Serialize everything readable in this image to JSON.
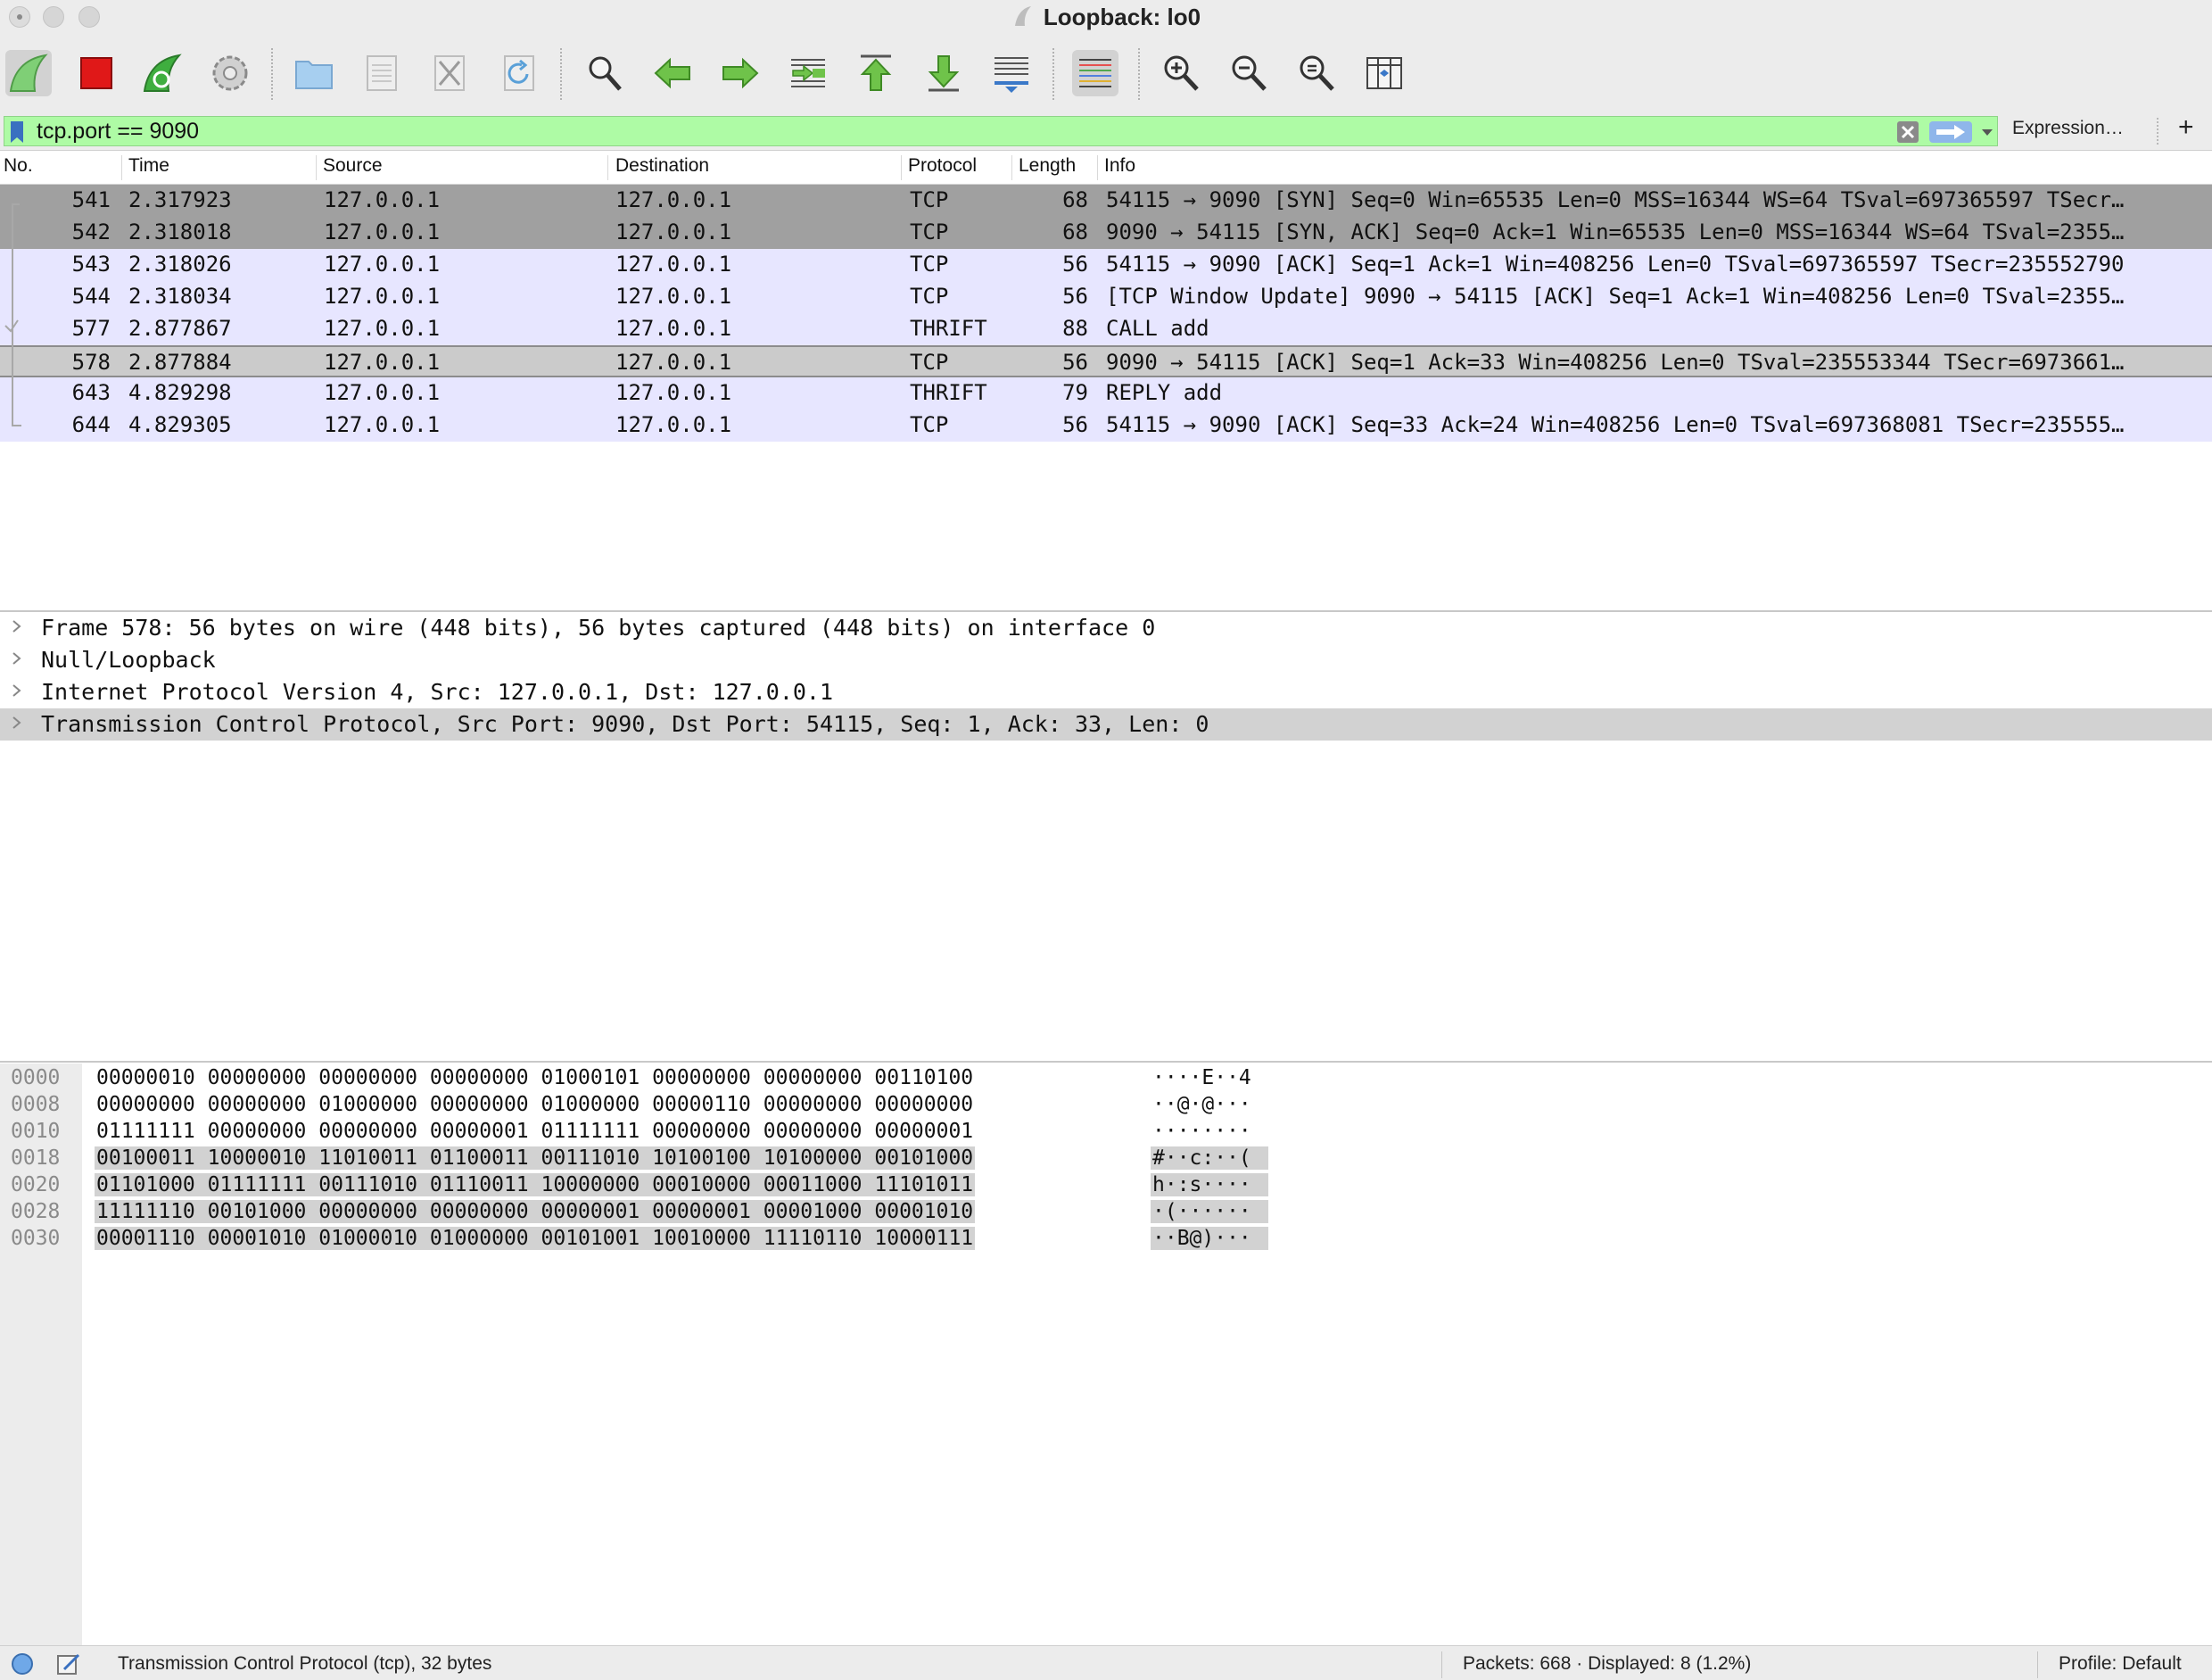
{
  "window": {
    "title": "Loopback: lo0"
  },
  "toolbar": {
    "buttons": [
      {
        "name": "start-capture-icon"
      },
      {
        "name": "stop-capture-icon"
      },
      {
        "name": "restart-capture-icon"
      },
      {
        "name": "capture-options-icon"
      },
      {
        "name": "open-file-icon"
      },
      {
        "name": "save-file-icon"
      },
      {
        "name": "close-file-icon"
      },
      {
        "name": "reload-file-icon"
      },
      {
        "name": "find-packet-icon"
      },
      {
        "name": "go-back-icon"
      },
      {
        "name": "go-forward-icon"
      },
      {
        "name": "go-to-packet-icon"
      },
      {
        "name": "first-packet-icon"
      },
      {
        "name": "last-packet-icon"
      },
      {
        "name": "autoscroll-icon"
      },
      {
        "name": "colorize-icon"
      },
      {
        "name": "zoom-in-icon"
      },
      {
        "name": "zoom-out-icon"
      },
      {
        "name": "normal-size-icon"
      },
      {
        "name": "resize-columns-icon"
      }
    ]
  },
  "filter": {
    "value": "tcp.port == 9090",
    "expression_label": "Expression…",
    "add_label": "+"
  },
  "columns": [
    "No.",
    "Time",
    "Source",
    "Destination",
    "Protocol",
    "Length",
    "Info"
  ],
  "packets": [
    {
      "no": "541",
      "time": "2.317923",
      "src": "127.0.0.1",
      "dst": "127.0.0.1",
      "proto": "TCP",
      "len": "68",
      "info": "54115 → 9090 [SYN] Seq=0 Win=65535 Len=0 MSS=16344 WS=64 TSval=697365597 TSecr…",
      "style": "dark"
    },
    {
      "no": "542",
      "time": "2.318018",
      "src": "127.0.0.1",
      "dst": "127.0.0.1",
      "proto": "TCP",
      "len": "68",
      "info": "9090 → 54115 [SYN, ACK] Seq=0 Ack=1 Win=65535 Len=0 MSS=16344 WS=64 TSval=2355…",
      "style": "dark"
    },
    {
      "no": "543",
      "time": "2.318026",
      "src": "127.0.0.1",
      "dst": "127.0.0.1",
      "proto": "TCP",
      "len": "56",
      "info": "54115 → 9090 [ACK] Seq=1 Ack=1 Win=408256 Len=0 TSval=697365597 TSecr=235552790",
      "style": "light"
    },
    {
      "no": "544",
      "time": "2.318034",
      "src": "127.0.0.1",
      "dst": "127.0.0.1",
      "proto": "TCP",
      "len": "56",
      "info": "[TCP Window Update] 9090 → 54115 [ACK] Seq=1 Ack=1 Win=408256 Len=0 TSval=2355…",
      "style": "light"
    },
    {
      "no": "577",
      "time": "2.877867",
      "src": "127.0.0.1",
      "dst": "127.0.0.1",
      "proto": "THRIFT",
      "len": "88",
      "info": "CALL add",
      "style": "light"
    },
    {
      "no": "578",
      "time": "2.877884",
      "src": "127.0.0.1",
      "dst": "127.0.0.1",
      "proto": "TCP",
      "len": "56",
      "info": "9090 → 54115 [ACK] Seq=1 Ack=33 Win=408256 Len=0 TSval=235553344 TSecr=6973661…",
      "style": "sel"
    },
    {
      "no": "643",
      "time": "4.829298",
      "src": "127.0.0.1",
      "dst": "127.0.0.1",
      "proto": "THRIFT",
      "len": "79",
      "info": "REPLY add",
      "style": "light"
    },
    {
      "no": "644",
      "time": "4.829305",
      "src": "127.0.0.1",
      "dst": "127.0.0.1",
      "proto": "TCP",
      "len": "56",
      "info": "54115 → 9090 [ACK] Seq=33 Ack=24 Win=408256 Len=0 TSval=697368081 TSecr=235555…",
      "style": "light"
    }
  ],
  "details": [
    {
      "text": "Frame 578: 56 bytes on wire (448 bits), 56 bytes captured (448 bits) on interface 0",
      "selected": false
    },
    {
      "text": "Null/Loopback",
      "selected": false
    },
    {
      "text": "Internet Protocol Version 4, Src: 127.0.0.1, Dst: 127.0.0.1",
      "selected": false
    },
    {
      "text": "Transmission Control Protocol, Src Port: 9090, Dst Port: 54115, Seq: 1, Ack: 33, Len: 0",
      "selected": true
    }
  ],
  "hex": [
    {
      "offset": "0000",
      "bin": "00000010 00000000 00000000 00000000 01000101 00000000 00000000 00110100",
      "ascii": "····E··4",
      "hl": false
    },
    {
      "offset": "0008",
      "bin": "00000000 00000000 01000000 00000000 01000000 00000110 00000000 00000000",
      "ascii": "··@·@···",
      "hl": false
    },
    {
      "offset": "0010",
      "bin": "01111111 00000000 00000000 00000001 01111111 00000000 00000000 00000001",
      "ascii": "········",
      "hl": false
    },
    {
      "offset": "0018",
      "bin": "00100011 10000010 11010011 01100011 00111010 10100100 10100000 00101000",
      "ascii": "#··c:··(",
      "hl": true
    },
    {
      "offset": "0020",
      "bin": "01101000 01111111 00111010 01110011 10000000 00010000 00011000 11101011",
      "ascii": "h·:s····",
      "hl": true
    },
    {
      "offset": "0028",
      "bin": "11111110 00101000 00000000 00000000 00000001 00000001 00001000 00001010",
      "ascii": "·(······",
      "hl": true
    },
    {
      "offset": "0030",
      "bin": "00001110 00001010 01000010 01000000 00101001 10010000 11110110 10000111",
      "ascii": "··B@)···",
      "hl": true
    }
  ],
  "status": {
    "field_info": "Transmission Control Protocol (tcp), 32 bytes",
    "packets": "Packets: 668 · Displayed: 8 (1.2%)",
    "profile": "Profile: Default"
  }
}
